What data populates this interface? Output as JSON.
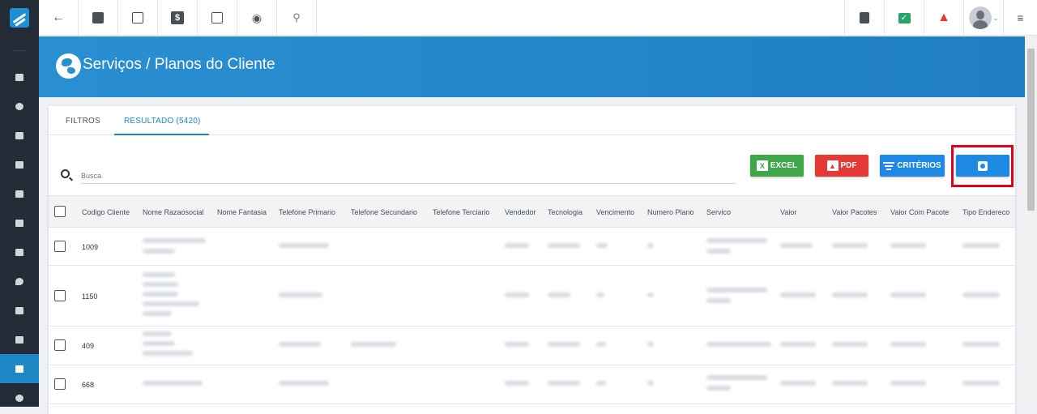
{
  "page": {
    "title": "Serviços / Planos do Cliente"
  },
  "sidebar": {
    "icons": [
      "dashboard-icon",
      "pie-icon",
      "contact-icon",
      "board-icon",
      "calendar-icon",
      "box-icon",
      "money-icon",
      "location-icon",
      "list-icon",
      "server-icon",
      "document-icon",
      "gear-icon"
    ],
    "active_index": 10
  },
  "topbar": {
    "left_icons": [
      "back-arrow-icon",
      "contact-card-icon",
      "calendar-clock-icon",
      "dollar-icon",
      "terminal-icon",
      "eye-icon",
      "search-icon"
    ],
    "right_icons": [
      "pdf-file-icon",
      "check-chat-icon",
      "alarm-icon",
      "avatar",
      "menu-list-icon"
    ]
  },
  "tabs": [
    {
      "label": "FILTROS",
      "active": false
    },
    {
      "label": "RESULTADO (5420)",
      "active": true
    }
  ],
  "search": {
    "placeholder": "Busca"
  },
  "toolbar": {
    "excel_label": "EXCEL",
    "pdf_label": "PDF",
    "criteria_label": "CRITÉRIOS"
  },
  "table": {
    "columns": [
      "Codigo Cliente",
      "Nome Razaosocial",
      "Nome Fantasia",
      "Telefone Primario",
      "Telefone Secundario",
      "Telefone Terciario",
      "Vendedor",
      "Tecnologia",
      "Vencimento",
      "Numero Plano",
      "Servico",
      "Valor",
      "Valor Pacotes",
      "Valor Com Pacote",
      "Tipo Endereco"
    ],
    "rows": [
      {
        "codigo": "1009"
      },
      {
        "codigo": "1150"
      },
      {
        "codigo": "409"
      },
      {
        "codigo": "668"
      }
    ]
  },
  "colors": {
    "accent": "#1e88c7",
    "excel": "#3fa64a",
    "pdf": "#e53935",
    "highlight": "#e0001b"
  }
}
